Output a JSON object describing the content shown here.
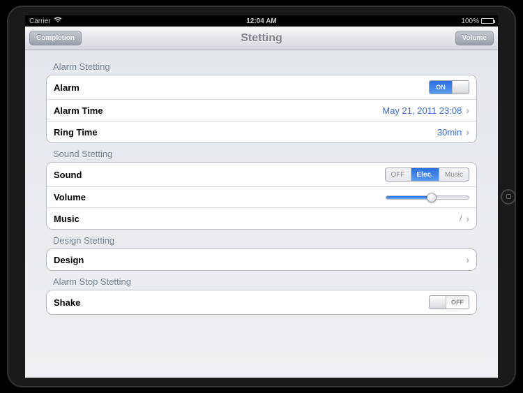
{
  "status_bar": {
    "carrier": "Carrier",
    "time": "12:04 AM",
    "battery": "100%"
  },
  "nav": {
    "left_button": "Completion",
    "title": "Stetting",
    "right_button": "Volume"
  },
  "sections": {
    "alarm": {
      "header": "Alarm Stetting",
      "rows": {
        "alarm_label": "Alarm",
        "alarm_switch": "ON",
        "time_label": "Alarm Time",
        "time_value": "May 21, 2011 23:08",
        "ring_label": "Ring Time",
        "ring_value": "30min"
      }
    },
    "sound": {
      "header": "Sound Stetting",
      "rows": {
        "sound_label": "Sound",
        "seg_off": "OFF",
        "seg_elec": "Elec.",
        "seg_music": "Music",
        "volume_label": "Volume",
        "volume_value": 55,
        "music_label": "Music",
        "music_value": "/"
      }
    },
    "design": {
      "header": "Design Stetting",
      "rows": {
        "design_label": "Design"
      }
    },
    "stop": {
      "header": "Alarm Stop Stetting",
      "rows": {
        "shake_label": "Shake",
        "shake_switch": "OFF"
      }
    }
  }
}
